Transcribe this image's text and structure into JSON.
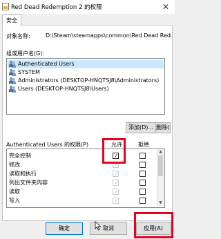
{
  "window": {
    "title": "Red Dead Redemption 2 的权限",
    "close_glyph": "✕"
  },
  "tabs": [
    {
      "label": "安全"
    }
  ],
  "object": {
    "label": "对象名称:",
    "value": "D:\\Steam\\steamapps\\common\\Red Dead Reder"
  },
  "groups": {
    "label": "组或用户名(G):",
    "items": [
      {
        "label": "Authenticated Users",
        "icon": "users-icon",
        "selected": true
      },
      {
        "label": "SYSTEM",
        "icon": "users-icon",
        "selected": false
      },
      {
        "label": "Administrators (DESKTOP-HNQTSJ8\\Administrators)",
        "icon": "users-icon",
        "selected": false
      },
      {
        "label": "Users (DESKTOP-HNQTSJ8\\Users)",
        "icon": "users-icon",
        "selected": false
      }
    ],
    "add_button": "添加(D)...",
    "remove_button": "删除(R)"
  },
  "permissions": {
    "label": "Authenticated Users 的权限(P)",
    "allow_header": "允许",
    "deny_header": "拒绝",
    "rows": [
      {
        "name": "完全控制",
        "allow": true,
        "deny": false
      },
      {
        "name": "修改",
        "allow": true,
        "deny": false
      },
      {
        "name": "读取和执行",
        "allow": true,
        "deny": false
      },
      {
        "name": "列出文件夹内容",
        "allow": true,
        "deny": false
      },
      {
        "name": "读取",
        "allow": true,
        "deny": false
      },
      {
        "name": "写入",
        "allow": true,
        "deny": false
      }
    ]
  },
  "buttons": {
    "ok": "确定",
    "cancel": "取消",
    "apply": "应用(A)"
  },
  "colors": {
    "highlight": "#e8001c",
    "selection": "#cce8ff"
  }
}
